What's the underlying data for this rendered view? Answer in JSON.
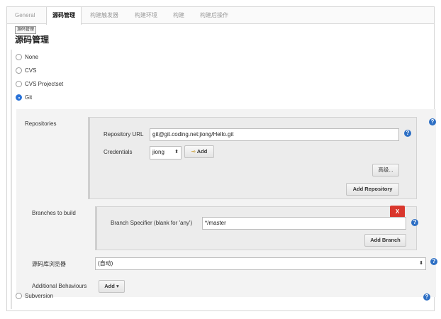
{
  "tabs": [
    {
      "label": "General",
      "active": false
    },
    {
      "label": "源码管理",
      "active": true
    },
    {
      "label": "构建触发器",
      "active": false
    },
    {
      "label": "构建环境",
      "active": false
    },
    {
      "label": "构建",
      "active": false
    },
    {
      "label": "构建后操作",
      "active": false
    }
  ],
  "tooltip": "源码管理",
  "section_title": "源码管理",
  "scm_options": [
    {
      "label": "None",
      "selected": false
    },
    {
      "label": "CVS",
      "selected": false
    },
    {
      "label": "CVS Projectset",
      "selected": false
    },
    {
      "label": "Git",
      "selected": true
    },
    {
      "label": "Subversion",
      "selected": false
    }
  ],
  "repositories": {
    "label": "Repositories",
    "url_label": "Repository URL",
    "url_value": "git@git.coding.net:jiong/Hello.git",
    "credentials_label": "Credentials",
    "credentials_value": "jiong",
    "add_cred_label": "Add",
    "advanced_label": "高级...",
    "add_repo_label": "Add Repository"
  },
  "branches": {
    "label": "Branches to build",
    "delete_label": "X",
    "specifier_label": "Branch Specifier (blank for 'any')",
    "specifier_value": "*/master",
    "add_branch_label": "Add Branch"
  },
  "browser": {
    "label": "源码库浏览器",
    "value": "(自动)"
  },
  "behaviours": {
    "label": "Additional Behaviours",
    "add_label": "Add"
  },
  "help_glyph": "?",
  "colors": {
    "accent_blue": "#2a73d8",
    "help_blue": "#2d6fc4",
    "delete_red": "#d9372d"
  }
}
